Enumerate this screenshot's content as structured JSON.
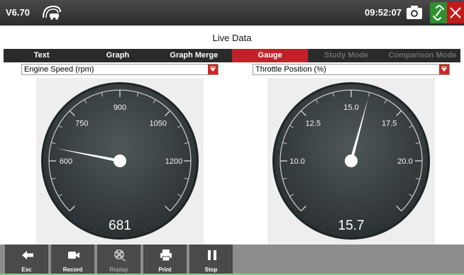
{
  "statusbar": {
    "version": "V6.70",
    "time": "09:52:07",
    "icons": [
      "vci-connection-icon",
      "camera-icon",
      "link-icon",
      "close-icon"
    ]
  },
  "page": {
    "title": "Live Data"
  },
  "tabs": [
    {
      "label": "Text",
      "state": "normal"
    },
    {
      "label": "Graph",
      "state": "normal"
    },
    {
      "label": "Graph Merge",
      "state": "normal"
    },
    {
      "label": "Gauge",
      "state": "active"
    },
    {
      "label": "Study Mode",
      "state": "disabled"
    },
    {
      "label": "Comparison Mode",
      "state": "disabled"
    }
  ],
  "gauges": [
    {
      "selector": "Engine Speed (rpm)",
      "tick_labels": [
        "600",
        "750",
        "900",
        "1050",
        "1200"
      ],
      "min": 525,
      "max": 1275,
      "value_number": 681,
      "value": "681"
    },
    {
      "selector": "Throttle Position (%)",
      "tick_labels": [
        "10.0",
        "12.5",
        "15.0",
        "17.5",
        "20.0"
      ],
      "min": 8.75,
      "max": 21.25,
      "value_number": 15.7,
      "value": "15.7"
    }
  ],
  "toolbar": {
    "buttons": [
      {
        "label": "Esc",
        "icon": "back-arrow-icon",
        "enabled": true
      },
      {
        "label": "Record",
        "icon": "video-camera-icon",
        "enabled": true
      },
      {
        "label": "Replay",
        "icon": "film-reel-icon",
        "enabled": false
      },
      {
        "label": "Print",
        "icon": "printer-icon",
        "enabled": true
      },
      {
        "label": "Stop",
        "icon": "pause-icon",
        "enabled": true
      }
    ]
  },
  "colors": {
    "accent": "#c0222a",
    "dial_face": "#3b4243",
    "dial_rim": "#1f2425",
    "ok": "#2f8f2f"
  }
}
